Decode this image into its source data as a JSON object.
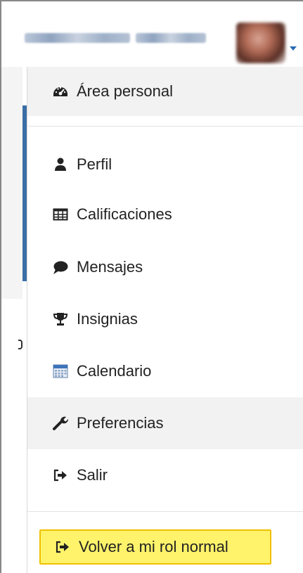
{
  "menu": {
    "items": [
      {
        "label": "Área personal",
        "icon": "dashboard-gauge-icon"
      },
      {
        "label": "Perfil",
        "icon": "user-icon"
      },
      {
        "label": "Calificaciones",
        "icon": "grades-table-icon"
      },
      {
        "label": "Mensajes",
        "icon": "comment-bubble-icon"
      },
      {
        "label": "Insignias",
        "icon": "trophy-icon"
      },
      {
        "label": "Calendario",
        "icon": "calendar-icon"
      },
      {
        "label": "Preferencias",
        "icon": "wrench-icon"
      },
      {
        "label": "Salir",
        "icon": "sign-out-icon"
      }
    ],
    "return_role_label": "Volver a mi rol normal",
    "return_role_icon": "sign-out-icon"
  },
  "colors": {
    "highlight_bg": "#f2f2f2",
    "role_button_bg": "#fff36b",
    "role_button_border": "#f0c000",
    "accent_blue": "#2a6bb5"
  }
}
